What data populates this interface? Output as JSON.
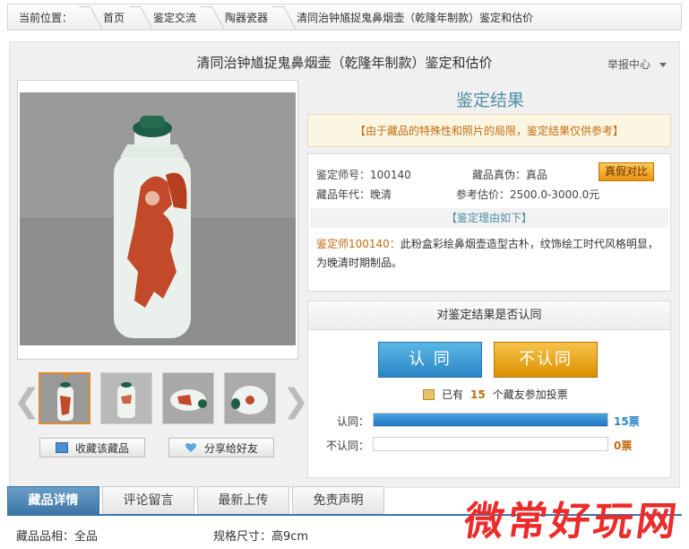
{
  "breadcrumb": {
    "items": [
      "当前位置：",
      "首页",
      "鉴定交流",
      "陶器瓷器",
      "清同治钟馗捉鬼鼻烟壶（乾隆年制款）鉴定和估价"
    ]
  },
  "header": {
    "title": "清同治钟馗捉鬼鼻烟壶（乾隆年制款）鉴定和估价",
    "report": "举报中心"
  },
  "gallery": {
    "collect_label": "收藏该藏品",
    "share_label": "分享给好友",
    "prev_icon": "chevron-left-icon",
    "next_icon": "chevron-right-icon"
  },
  "result": {
    "title": "鉴定结果",
    "notice": "【由于藏品的特殊性和照片的局限，鉴定结果仅供参考】",
    "appraiser_no": "鉴定师号：100140",
    "authenticity": "藏品真伪：真品",
    "compare_button": "真假对比",
    "era": "藏品年代：晚清",
    "estimate": "参考估价：2500.0-3000.0元",
    "reason_head": "【鉴定理由如下】",
    "reason_who": "鉴定师100140：",
    "reason_text": "此粉盒彩绘鼻烟壶造型古朴，纹饰绘工时代风格明显，为晚清时期制品。"
  },
  "vote": {
    "heading": "对鉴定结果是否认同",
    "agree_button": "认 同",
    "disagree_button": "不认同",
    "count_prefix": "已有",
    "count": "15",
    "count_suffix": "个藏友参加投票",
    "agree_label": "认同：",
    "agree_value": "15票",
    "agree_fraction": 1.0,
    "disagree_label": "不认同：",
    "disagree_value": "0票",
    "disagree_fraction": 0.0,
    "agree_color": "#2a86c5",
    "disagree_color": "#c26b12"
  },
  "tabs": [
    "藏品详情",
    "评论留言",
    "最新上传",
    "免责声明"
  ],
  "details": {
    "condition": "藏品品相：全品",
    "size": "规格尺寸：高9cm"
  },
  "watermark": "微常好玩网"
}
